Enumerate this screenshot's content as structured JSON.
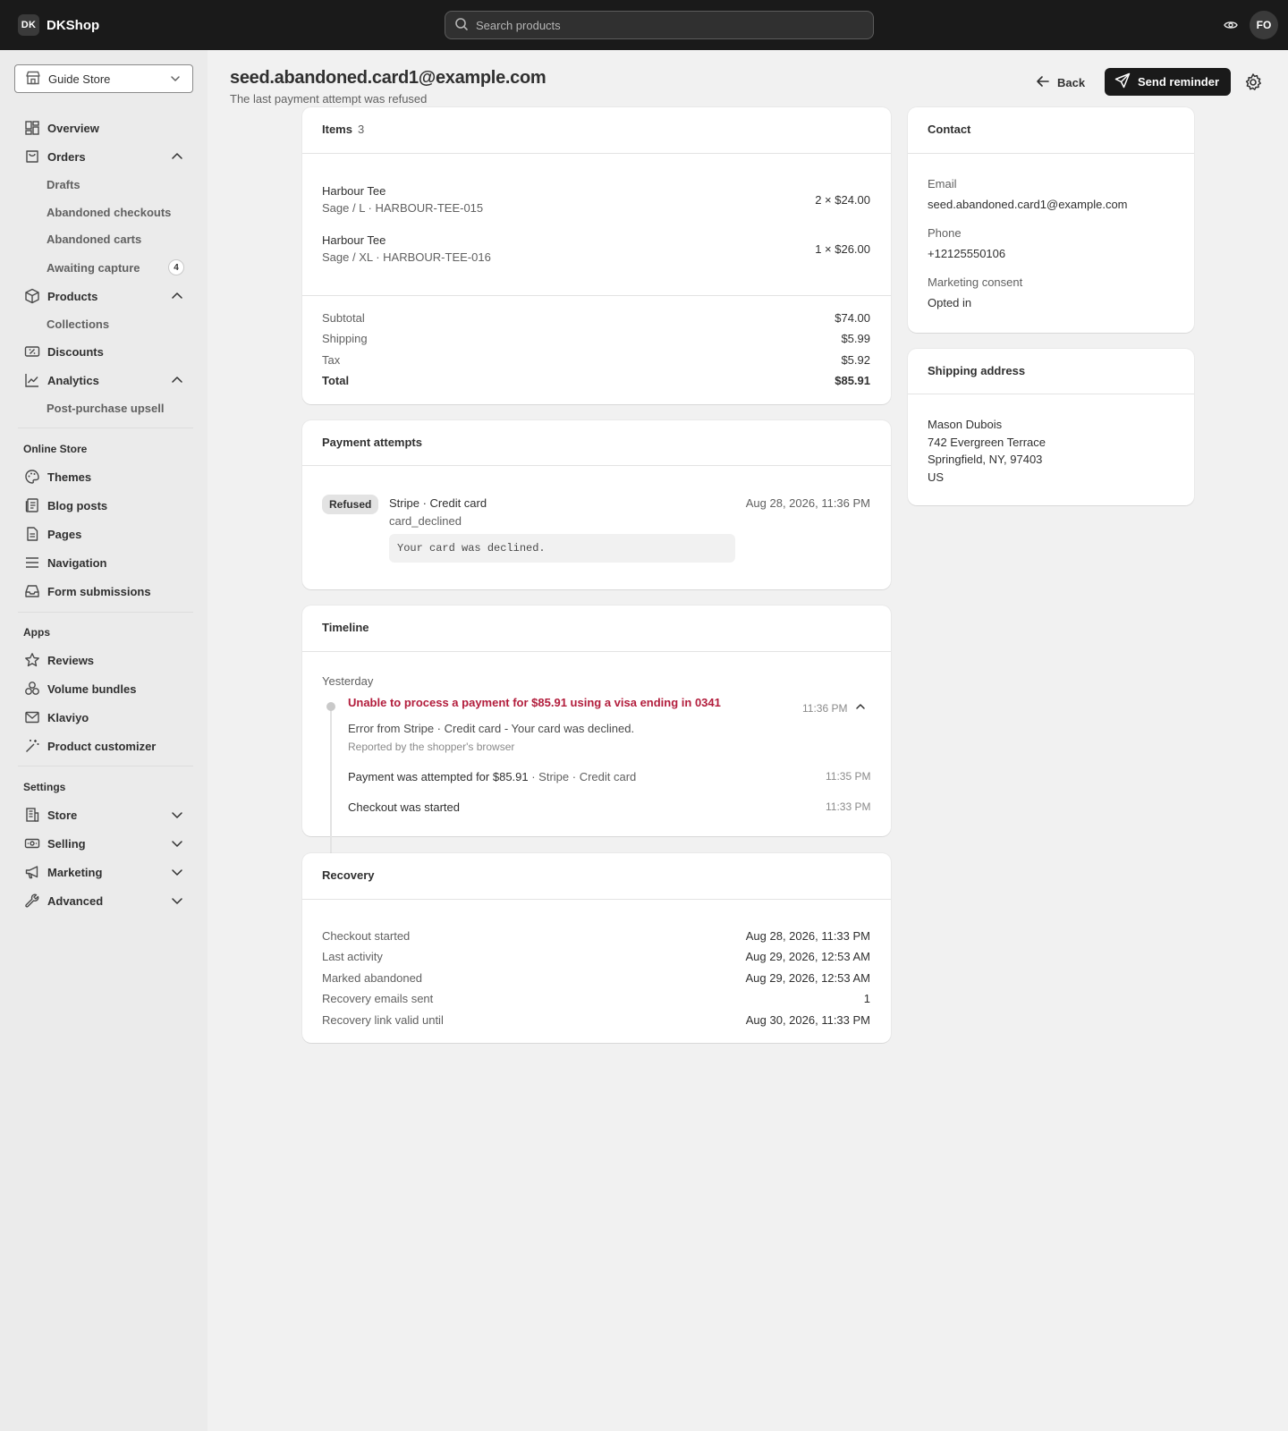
{
  "topbar": {
    "brand_mark": "DK",
    "brand_name": "DKShop",
    "search_placeholder": "Search products",
    "avatar_initials": "FO"
  },
  "sidebar": {
    "store_name": "Guide Store",
    "main_nav": [
      {
        "label": "Overview"
      },
      {
        "label": "Orders"
      },
      {
        "label": "Drafts"
      },
      {
        "label": "Abandoned checkouts"
      },
      {
        "label": "Abandoned carts"
      },
      {
        "label": "Awaiting capture",
        "badge": "4"
      },
      {
        "label": "Products"
      },
      {
        "label": "Collections"
      },
      {
        "label": "Discounts"
      },
      {
        "label": "Analytics"
      },
      {
        "label": "Post-purchase upsell"
      }
    ],
    "online_store": {
      "heading": "Online Store",
      "items": [
        {
          "label": "Themes"
        },
        {
          "label": "Blog posts"
        },
        {
          "label": "Pages"
        },
        {
          "label": "Navigation"
        },
        {
          "label": "Form submissions"
        }
      ]
    },
    "apps": {
      "heading": "Apps",
      "items": [
        {
          "label": "Reviews"
        },
        {
          "label": "Volume bundles"
        },
        {
          "label": "Klaviyo"
        },
        {
          "label": "Product customizer"
        }
      ]
    },
    "settings": {
      "heading": "Settings",
      "items": [
        {
          "label": "Store"
        },
        {
          "label": "Selling"
        },
        {
          "label": "Marketing"
        },
        {
          "label": "Advanced"
        }
      ]
    }
  },
  "header": {
    "title": "seed.abandoned.card1@example.com",
    "subtitle": "The last payment attempt was refused",
    "back_label": "Back",
    "send_label": "Send reminder"
  },
  "items_card": {
    "title": "Items",
    "count": "3",
    "lines": [
      {
        "name": "Harbour Tee",
        "variant": "Sage / L · HARBOUR-TEE-015",
        "qty_price": "2 × $24.00"
      },
      {
        "name": "Harbour Tee",
        "variant": "Sage / XL · HARBOUR-TEE-016",
        "qty_price": "1 × $26.00"
      }
    ],
    "totals": [
      {
        "label": "Subtotal",
        "value": "$74.00"
      },
      {
        "label": "Shipping",
        "value": "$5.99"
      },
      {
        "label": "Tax",
        "value": "$5.92"
      },
      {
        "label": "Total",
        "value": "$85.91"
      }
    ]
  },
  "payment_card": {
    "title": "Payment attempts",
    "status": "Refused",
    "method": "Stripe · Credit card",
    "code": "card_declined",
    "message": "Your card was declined.",
    "date": "Aug 28, 2026, 11:36 PM"
  },
  "timeline_card": {
    "title": "Timeline",
    "day": "Yesterday",
    "error_title": "Unable to process a payment for $85.91 using a visa ending in 0341",
    "error_time": "11:36 PM",
    "error_detail": "Error from Stripe · Credit card - Your card was declined.",
    "error_source": "Reported by the shopper's browser",
    "events": [
      {
        "text": "Payment was attempted for $85.91",
        "meta": " · Stripe · Credit card",
        "time": "11:35 PM"
      },
      {
        "text": "Checkout was started",
        "meta": "",
        "time": "11:33 PM"
      }
    ]
  },
  "recovery_card": {
    "title": "Recovery",
    "rows": [
      {
        "label": "Checkout started",
        "value": "Aug 28, 2026, 11:33 PM"
      },
      {
        "label": "Last activity",
        "value": "Aug 29, 2026, 12:53 AM"
      },
      {
        "label": "Marked abandoned",
        "value": "Aug 29, 2026, 12:53 AM"
      },
      {
        "label": "Recovery emails sent",
        "value": "1"
      },
      {
        "label": "Recovery link valid until",
        "value": "Aug 30, 2026, 11:33 PM"
      }
    ]
  },
  "contact_card": {
    "title": "Contact",
    "email_label": "Email",
    "email": "seed.abandoned.card1@example.com",
    "phone_label": "Phone",
    "phone": "+12125550106",
    "consent_label": "Marketing consent",
    "consent": "Opted in"
  },
  "shipping_card": {
    "title": "Shipping address",
    "lines": [
      "Mason Dubois",
      "742 Evergreen Terrace",
      "Springfield, NY, 97403",
      "US"
    ]
  },
  "colors": {
    "topbar_bg": "#1a1a1a",
    "primary_button": "#1a1a1a",
    "error_text": "#b21d3c",
    "page_bg": "#f1f1f1"
  }
}
